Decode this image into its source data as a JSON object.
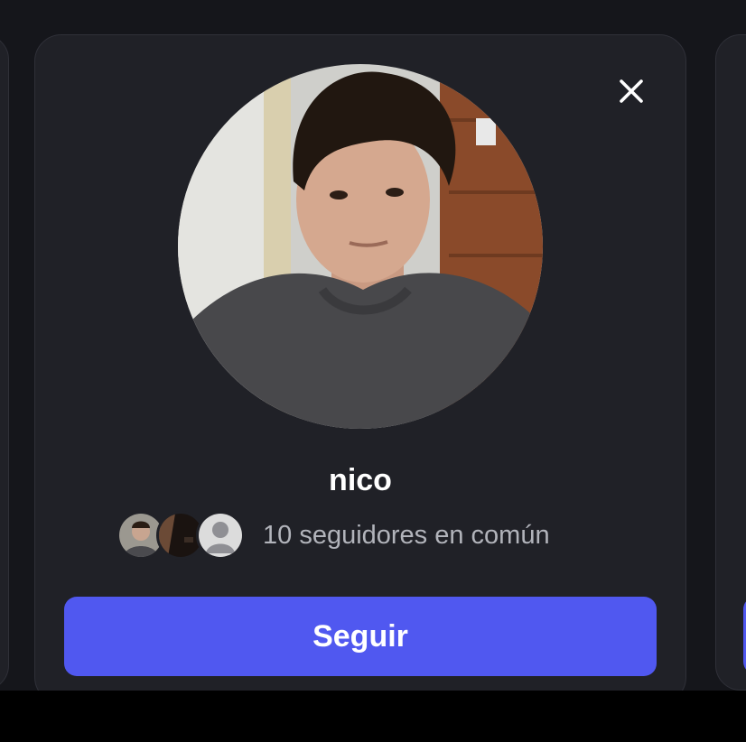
{
  "suggestion_card": {
    "username": "nico",
    "mutual_followers_text": "10 seguidores en común",
    "follow_button_label": "Seguir",
    "close_icon": "close-icon",
    "mutual_avatars": [
      "mutual-avatar-photo",
      "mutual-avatar-dark",
      "default-avatar-icon"
    ]
  },
  "colors": {
    "background": "#15161b",
    "card": "#202127",
    "accent": "#5058f0",
    "text_primary": "#ffffff",
    "text_secondary": "#b2b4bb"
  }
}
